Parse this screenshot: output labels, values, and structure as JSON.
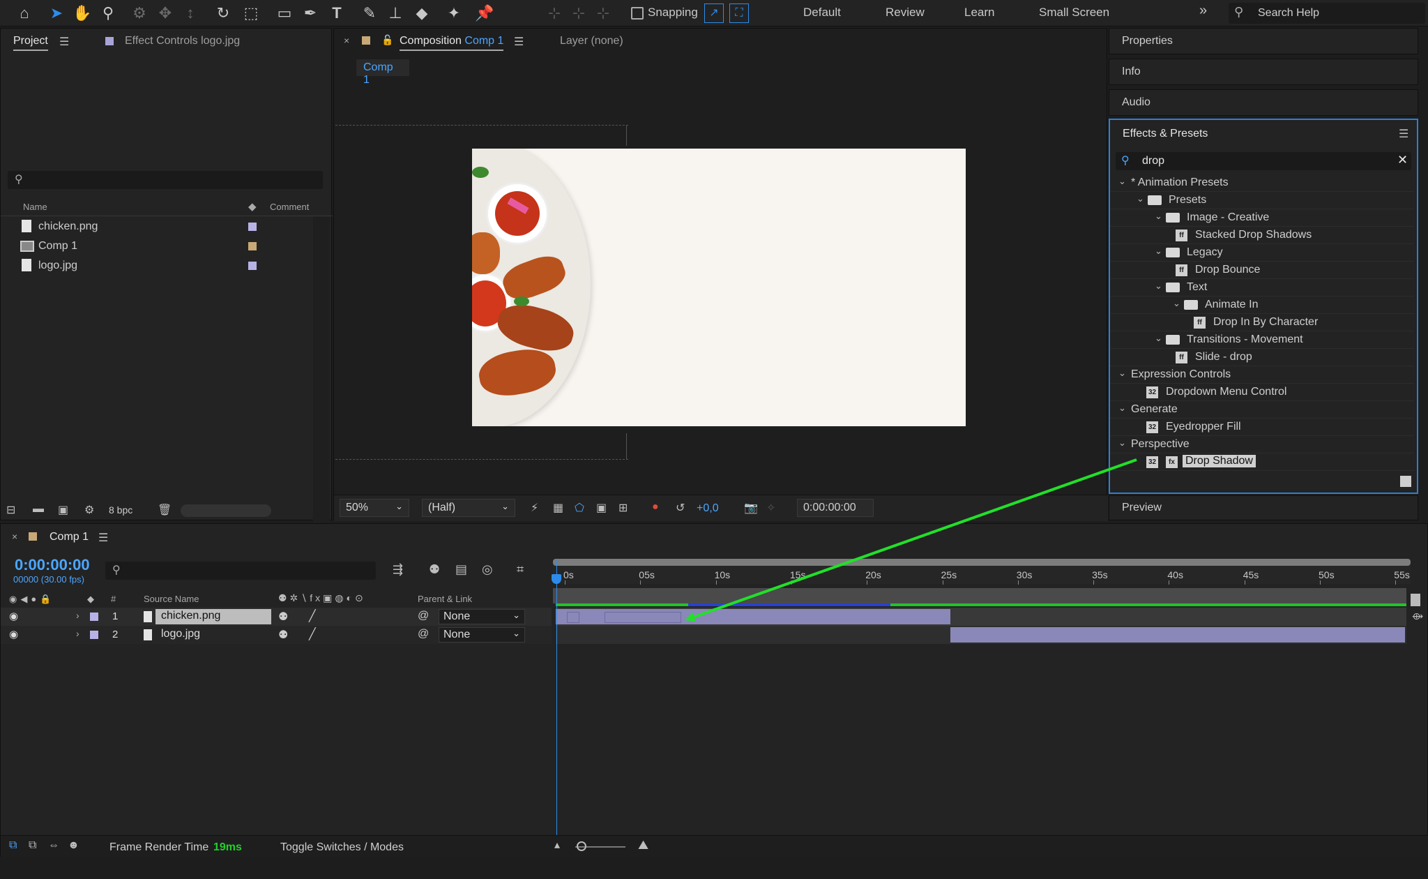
{
  "toolbar": {
    "snapping_label": "Snapping",
    "workspaces": [
      "Default",
      "Review",
      "Learn",
      "Small Screen"
    ],
    "more": "»",
    "search_placeholder": "Search Help"
  },
  "project_panel": {
    "tab_project": "Project",
    "tab_effect_controls": "Effect Controls logo.jpg",
    "col_name": "Name",
    "col_comment": "Comment",
    "items": [
      {
        "name": "chicken.png",
        "color": "#b7b2e6"
      },
      {
        "name": "Comp 1",
        "color": "#c9a877"
      },
      {
        "name": "logo.jpg",
        "color": "#b7b2e6"
      }
    ],
    "bpc": "8 bpc"
  },
  "comp_panel": {
    "tab_prefix": "Composition",
    "tab_comp": "Comp 1",
    "tab_layer": "Layer (none)",
    "subtab": "Comp 1",
    "zoom": "50%",
    "resolution": "(Half)",
    "exposure": "+0,0",
    "timecode": "0:00:00:00"
  },
  "right_panels": {
    "properties": "Properties",
    "info": "Info",
    "audio": "Audio",
    "preview": "Preview"
  },
  "effects_presets": {
    "title": "Effects & Presets",
    "search_value": "drop",
    "rows": [
      {
        "label": "* Animation Presets",
        "indent": 0,
        "kind": "cat"
      },
      {
        "label": "Presets",
        "indent": 1,
        "kind": "folder"
      },
      {
        "label": "Image - Creative",
        "indent": 2,
        "kind": "folder"
      },
      {
        "label": "Stacked Drop Shadows",
        "indent": 3,
        "kind": "preset"
      },
      {
        "label": "Legacy",
        "indent": 2,
        "kind": "folder"
      },
      {
        "label": "Drop Bounce",
        "indent": 3,
        "kind": "preset"
      },
      {
        "label": "Text",
        "indent": 2,
        "kind": "folder"
      },
      {
        "label": "Animate In",
        "indent": 3,
        "kind": "folder"
      },
      {
        "label": "Drop In By Character",
        "indent": 4,
        "kind": "preset"
      },
      {
        "label": "Transitions - Movement",
        "indent": 2,
        "kind": "folder"
      },
      {
        "label": "Slide - drop",
        "indent": 3,
        "kind": "preset"
      },
      {
        "label": "Expression Controls",
        "indent": 0,
        "kind": "cat"
      },
      {
        "label": "Dropdown Menu Control",
        "indent": 1,
        "kind": "effect"
      },
      {
        "label": "Generate",
        "indent": 0,
        "kind": "cat"
      },
      {
        "label": "Eyedropper Fill",
        "indent": 1,
        "kind": "effect"
      },
      {
        "label": "Perspective",
        "indent": 0,
        "kind": "cat"
      },
      {
        "label": "Drop Shadow",
        "indent": 1,
        "kind": "effect-selected"
      }
    ]
  },
  "timeline": {
    "comp_name": "Comp 1",
    "timecode": "0:00:00:00",
    "frame_info": "00000 (30.00 fps)",
    "col_hash": "#",
    "col_source": "Source Name",
    "col_parent": "Parent & Link",
    "layers": [
      {
        "num": "1",
        "name": "chicken.png",
        "parent": "None"
      },
      {
        "num": "2",
        "name": "logo.jpg",
        "parent": "None"
      }
    ],
    "ticks": [
      "0s",
      "05s",
      "10s",
      "15s",
      "20s",
      "25s",
      "30s",
      "35s",
      "40s",
      "45s",
      "50s",
      "55s"
    ]
  },
  "status": {
    "frame_render_label": "Frame Render Time",
    "frame_render_value": "19ms",
    "toggle": "Toggle Switches / Modes"
  },
  "colors": {
    "accent": "#2d8ceb",
    "arrow": "#22e02a",
    "bar": "#8a88b8"
  }
}
